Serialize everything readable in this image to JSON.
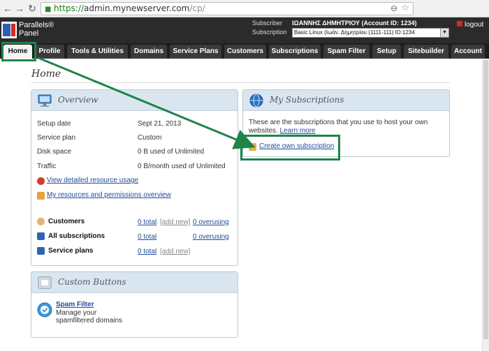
{
  "browser": {
    "url_scheme": "https://",
    "url_host": "admin.mynewserver.com",
    "url_path": "/cp/"
  },
  "header": {
    "logo_line1": "Parallels®",
    "logo_line2": "Panel",
    "subscriber_label": "Subscriber",
    "subscription_label": "Subscription",
    "subscriber_name": "ΙΩΑΝΝΗΣ ΔΗΜΗΤΡΙΟΥ (Account ID: 1234)",
    "subscription_value": "Basic Linux (Ιωάν. Δημητρίου (1111-111) ID:1234",
    "logout": "logout"
  },
  "tabs": [
    {
      "label": "Home"
    },
    {
      "label": "Profile"
    },
    {
      "label": "Tools & Utilities"
    },
    {
      "label": "Domains"
    },
    {
      "label": "Service Plans"
    },
    {
      "label": "Customers"
    },
    {
      "label": "Subscriptions"
    },
    {
      "label": "Spam Filter"
    },
    {
      "label": "Setup"
    },
    {
      "label": "Sitebuilder"
    },
    {
      "label": "Account"
    }
  ],
  "page": {
    "title": "Home"
  },
  "overview": {
    "title": "Overview",
    "rows": [
      {
        "label": "Setup date",
        "value": "Sept 21, 2013"
      },
      {
        "label": "Service plan",
        "value": "Custom"
      },
      {
        "label": "Disk space",
        "value": "0 B used of Unlimited"
      },
      {
        "label": "Traffic",
        "value": "0 B/month used of Unlimited"
      }
    ],
    "link_usage": "View detailed resource usage",
    "link_resources": "My resources and permissions overview",
    "stats": [
      {
        "label": "Customers",
        "total": "0 total",
        "add": "[add new]",
        "over": "0 overusing"
      },
      {
        "label": "All subscriptions",
        "total": "0 total",
        "add": "",
        "over": "0 overusing"
      },
      {
        "label": "Service plans",
        "total": "0 total",
        "add": "[add new]",
        "over": ""
      }
    ]
  },
  "subscriptions": {
    "title": "My Subscriptions",
    "text": "These are the subscriptions that you use to host your own websites.",
    "learn_more": "Learn more",
    "create": "Create own subscription"
  },
  "custom_buttons": {
    "title": "Custom Buttons",
    "spam_title": "Spam Filter",
    "spam_desc_1": "Manage your",
    "spam_desc_2": "spamfiltered domains"
  },
  "colors": {
    "highlight": "#1e8449",
    "header_bg": "#2b2b2b",
    "link": "#1f4a9a"
  }
}
